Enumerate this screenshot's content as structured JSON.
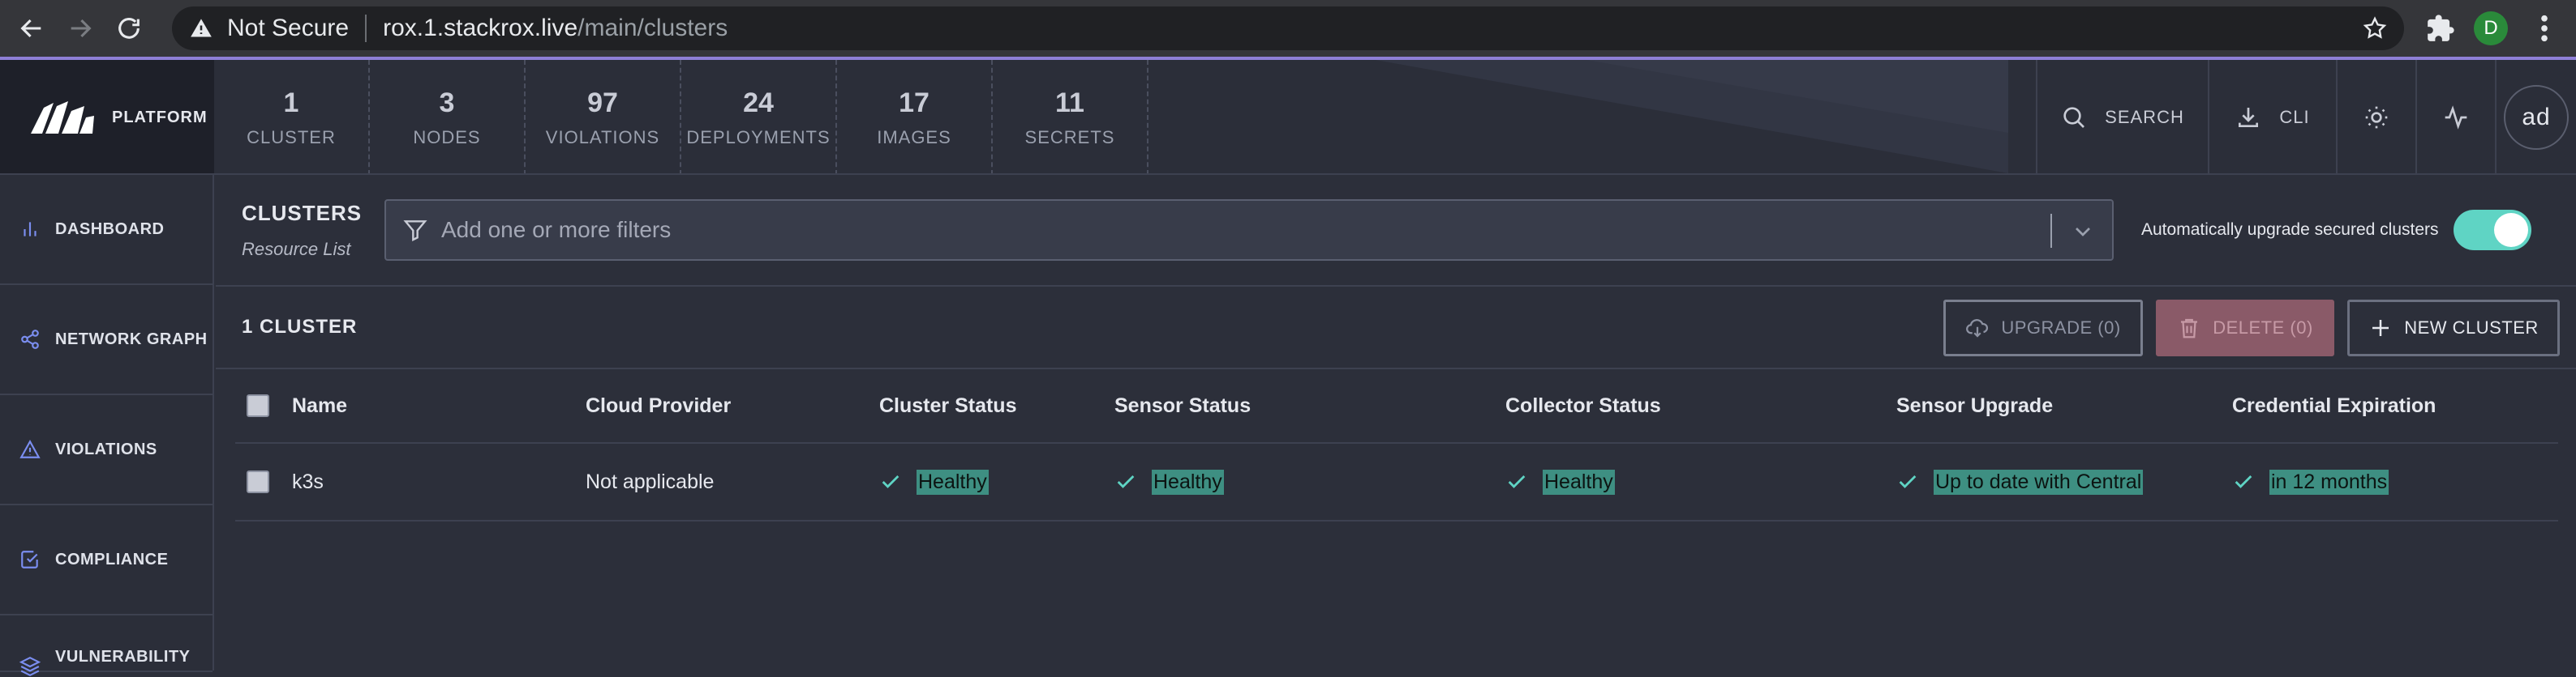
{
  "browser": {
    "security_label": "Not Secure",
    "url_host": "rox.1.stackrox.live",
    "url_path": "/main/clusters",
    "profile_initial": "D"
  },
  "topbar": {
    "logo_text": "PLATFORM",
    "summary": [
      {
        "count": "1",
        "label": "CLUSTER"
      },
      {
        "count": "3",
        "label": "NODES"
      },
      {
        "count": "97",
        "label": "VIOLATIONS"
      },
      {
        "count": "24",
        "label": "DEPLOYMENTS"
      },
      {
        "count": "17",
        "label": "IMAGES"
      },
      {
        "count": "11",
        "label": "SECRETS"
      }
    ],
    "search_label": "SEARCH",
    "cli_label": "CLI",
    "user_initials": "ad"
  },
  "sidebar": {
    "items": [
      {
        "label": "DASHBOARD",
        "icon": "bar-chart-icon"
      },
      {
        "label": "NETWORK GRAPH",
        "icon": "share-icon"
      },
      {
        "label": "VIOLATIONS",
        "icon": "alert-triangle-icon"
      },
      {
        "label": "COMPLIANCE",
        "icon": "check-square-icon"
      },
      {
        "label": "VULNERABILITY",
        "icon": "layers-icon"
      }
    ]
  },
  "page": {
    "title": "CLUSTERS",
    "subtitle": "Resource List",
    "filter_placeholder": "Add one or more filters",
    "auto_upgrade_label": "Automatically upgrade secured clusters",
    "auto_upgrade_enabled": true,
    "cluster_count": "1 CLUSTER",
    "upgrade_button": "UPGRADE (0)",
    "delete_button": "DELETE (0)",
    "new_button": "NEW CLUSTER"
  },
  "table": {
    "headers": {
      "name": "Name",
      "cloud": "Cloud Provider",
      "cluster_status": "Cluster Status",
      "sensor_status": "Sensor Status",
      "collector_status": "Collector Status",
      "sensor_upgrade": "Sensor Upgrade",
      "credential": "Credential Expiration"
    },
    "rows": [
      {
        "name": "k3s",
        "cloud": "Not applicable",
        "cluster_status": "Healthy",
        "sensor_status": "Healthy",
        "collector_status": "Healthy",
        "sensor_upgrade": "Up to date with Central",
        "credential": "in 12 months"
      }
    ]
  },
  "colors": {
    "accent": "#5fd4c4",
    "healthy_highlight": "#3e8f82",
    "top_border": "#8e7fd6",
    "delete": "#8a5a68"
  }
}
